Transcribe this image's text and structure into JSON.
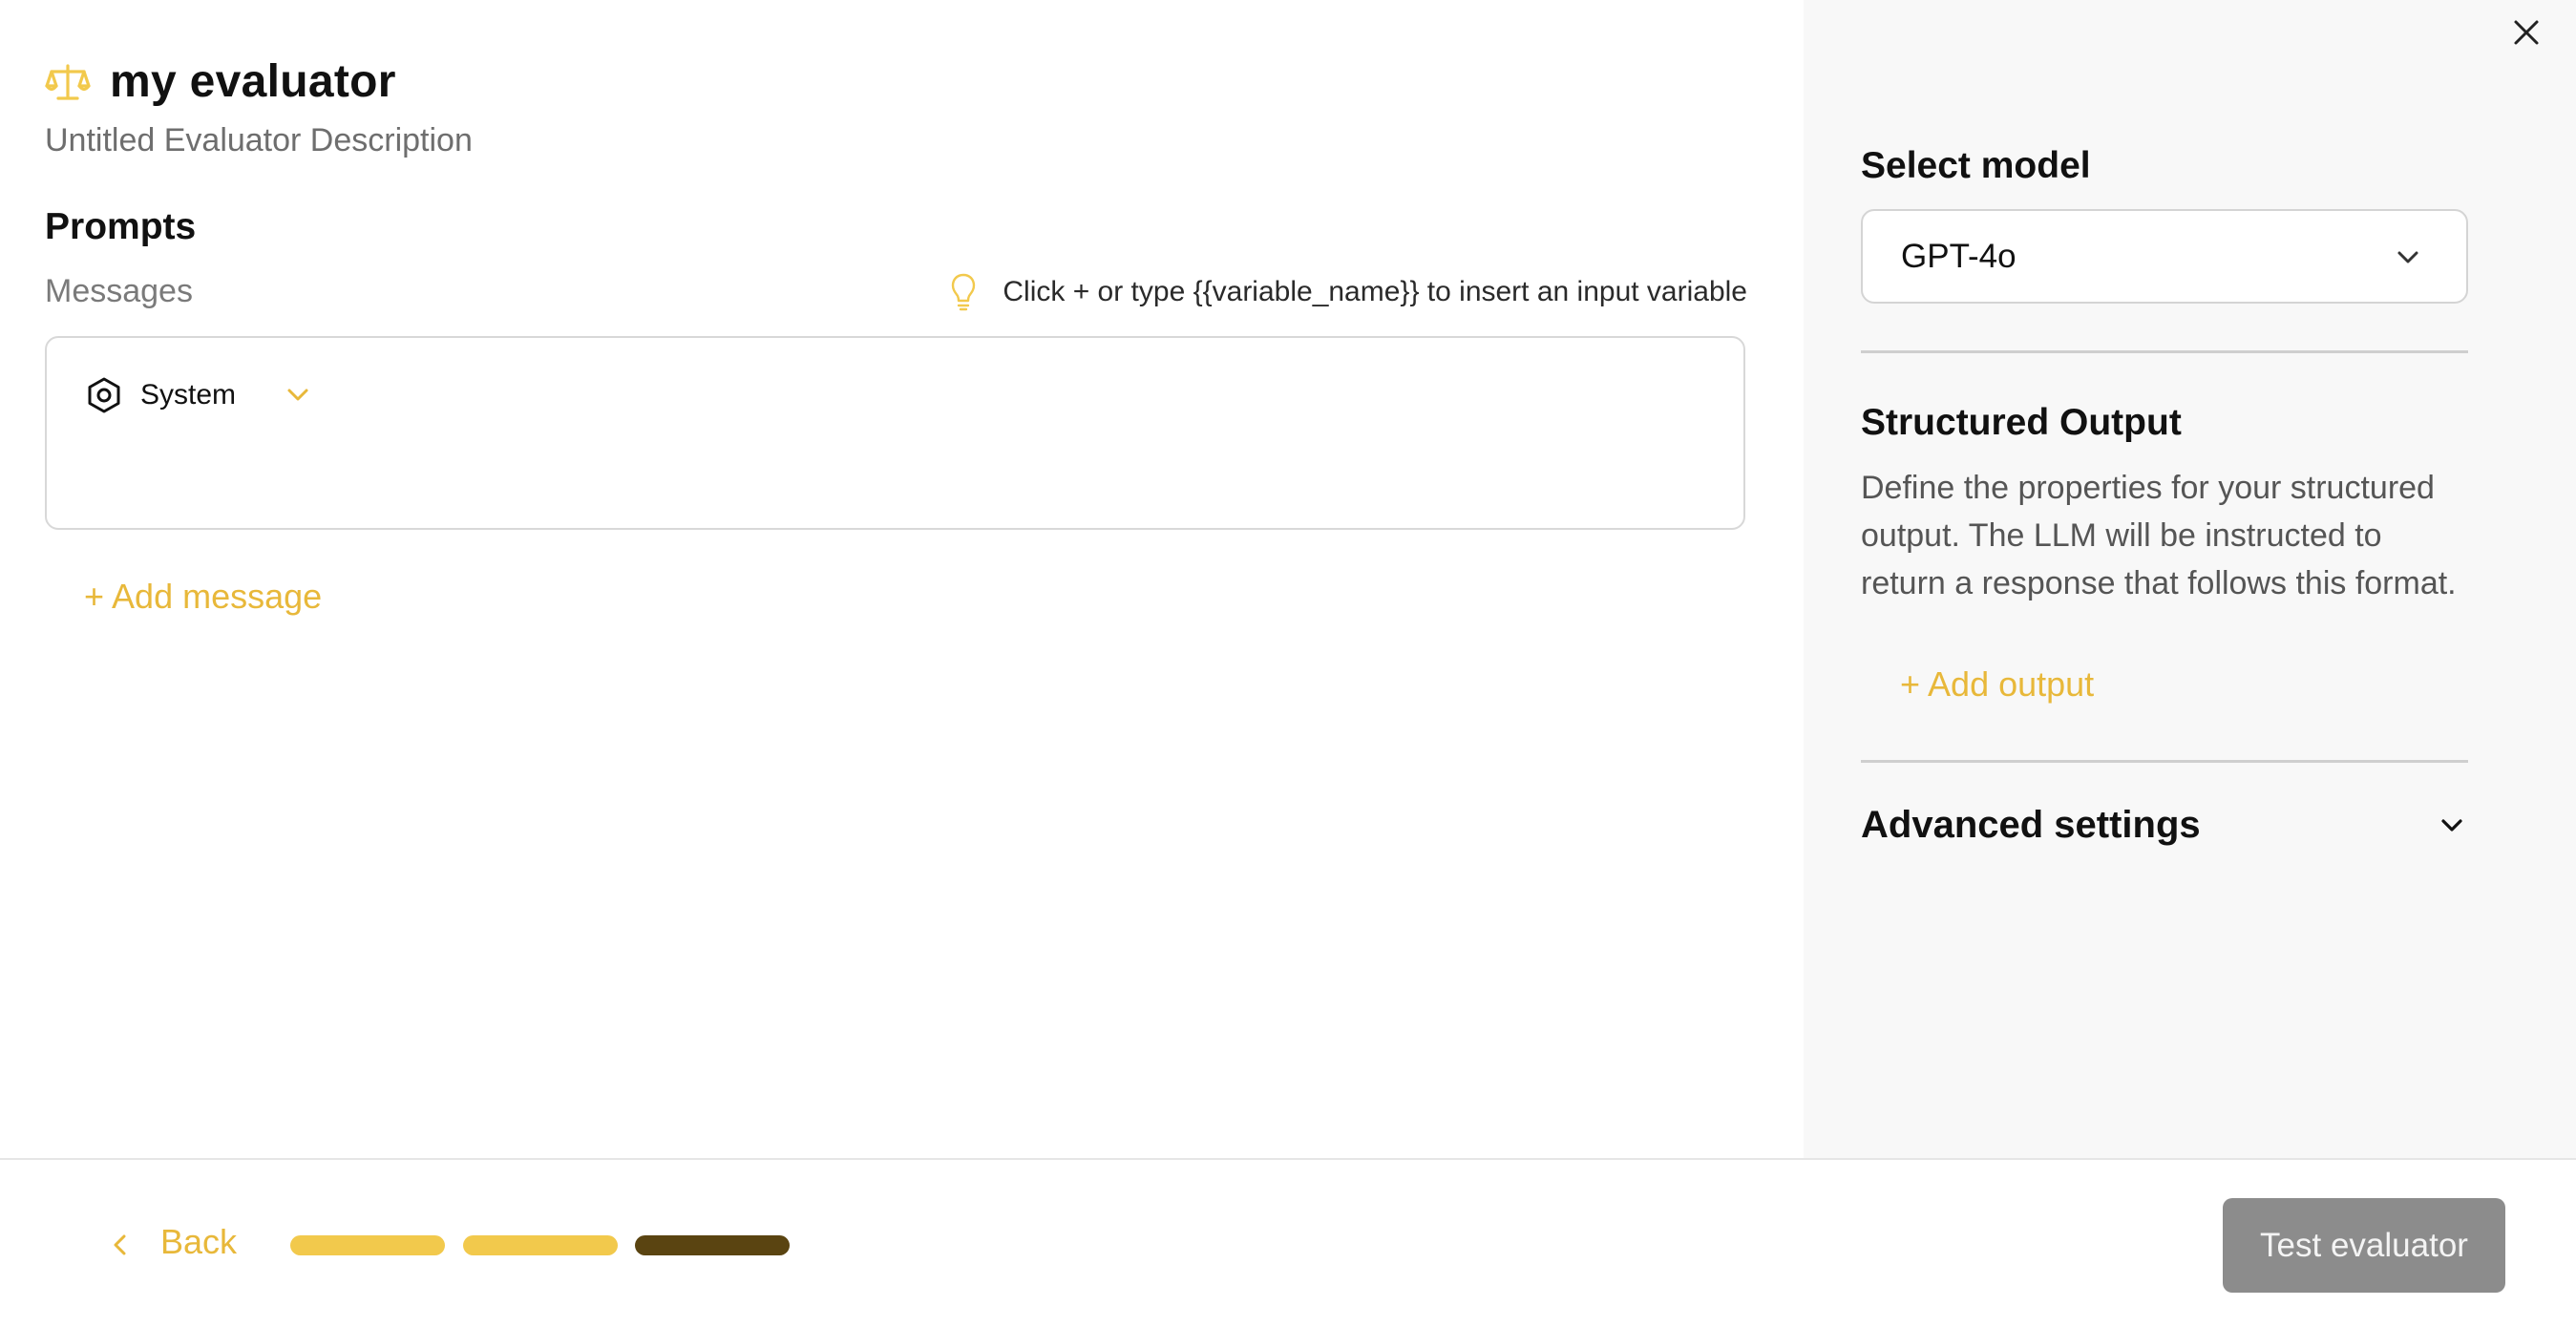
{
  "header": {
    "title": "my evaluator",
    "description": "Untitled Evaluator Description",
    "title_icon": "scale-icon"
  },
  "prompts": {
    "heading": "Prompts",
    "messages_label": "Messages",
    "hint": "Click + or type {{variable_name}} to insert an input variable",
    "messages": [
      {
        "role": "System",
        "content": ""
      }
    ],
    "add_message_label": "+ Add message"
  },
  "sidebar": {
    "model_heading": "Select model",
    "model_value": "GPT-4o",
    "structured_output_heading": "Structured Output",
    "structured_output_description": "Define the properties for your structured output. The LLM will be instructed to return a response that follows this format.",
    "add_output_label": "+ Add output",
    "advanced_settings_label": "Advanced settings"
  },
  "footer": {
    "back_label": "Back",
    "steps": {
      "total": 3,
      "current": 3
    },
    "test_button_label": "Test evaluator"
  },
  "colors": {
    "accent": "#e8b83a",
    "step_done": "#f2c94c",
    "step_current": "#5a4411",
    "button_disabled": "#8c8c8c",
    "sidebar_bg": "#f8f8f8"
  }
}
